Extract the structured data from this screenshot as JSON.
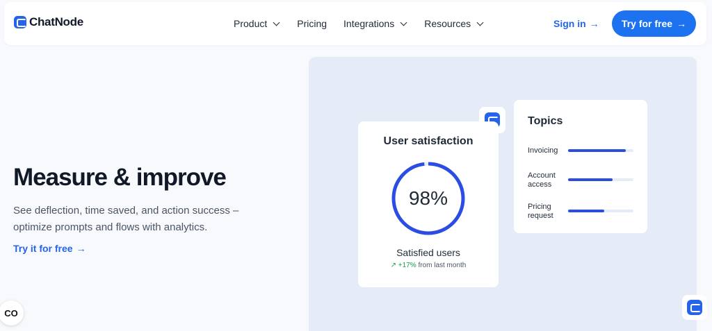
{
  "brand": {
    "name": "ChatNode"
  },
  "nav": {
    "items": [
      {
        "label": "Product",
        "dropdown": true
      },
      {
        "label": "Pricing",
        "dropdown": false
      },
      {
        "label": "Integrations",
        "dropdown": true
      },
      {
        "label": "Resources",
        "dropdown": true
      }
    ],
    "signin_label": "Sign in",
    "cta_label": "Try for free",
    "arrow": "→"
  },
  "hero": {
    "title": "Measure & improve",
    "description": "See deflection, time saved, and action success – optimize prompts and flows with analytics.",
    "link_label": "Try it for free",
    "link_arrow": "→"
  },
  "cookie_button": {
    "label": "CO"
  },
  "satisfaction_card": {
    "title": "User satisfaction",
    "percent": 98,
    "percent_label": "98%",
    "label": "Satisfied users",
    "trend_icon": "trending-up-icon",
    "trend_value": "+17%",
    "trend_text": "from last month"
  },
  "topics_card": {
    "title": "Topics",
    "topics": [
      {
        "name": "Invoicing",
        "share": 0.88
      },
      {
        "name": "Account access",
        "share": 0.68
      },
      {
        "name": "Pricing request",
        "share": 0.55
      }
    ]
  },
  "colors": {
    "accent": "#2563eb",
    "cta": "#1d72f0",
    "panel": "#e6ecf7",
    "trend_up": "#16a34a",
    "bar": "#2b4de3"
  }
}
